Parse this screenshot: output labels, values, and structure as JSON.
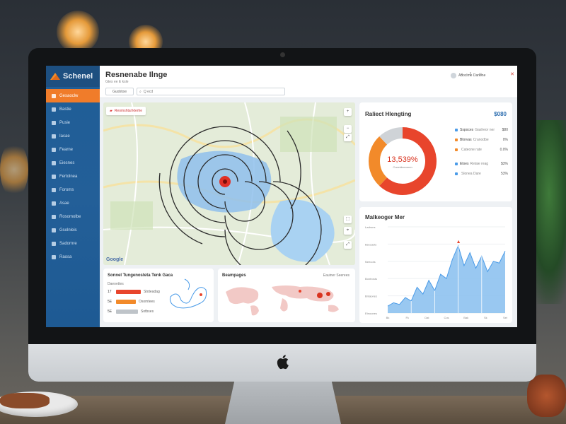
{
  "app": {
    "brand_name": "Schenel",
    "page_title": "Resnenabe Ilnge",
    "subtitle": "Gtes ee E ksle",
    "filter_label": "Guobtow",
    "search_placeholder": "Q ecd",
    "user_name": "Aboclme Danone"
  },
  "sidebar": {
    "items": [
      {
        "label": "Gesaoclw",
        "active": true
      },
      {
        "label": "Bastie"
      },
      {
        "label": "Pusie"
      },
      {
        "label": "Iacae"
      },
      {
        "label": "Fearne"
      },
      {
        "label": "Eiesnes"
      },
      {
        "label": "Fertolnea"
      },
      {
        "label": "Foroms"
      },
      {
        "label": "Asae"
      },
      {
        "label": "Rosomolbe"
      },
      {
        "label": "Gsolnleis"
      },
      {
        "label": "Sadornre"
      },
      {
        "label": "Raosa"
      }
    ]
  },
  "map": {
    "badge_label": "Reomshtal kIerhe",
    "attribution": "Google",
    "controls": [
      "+",
      "−",
      "⤢",
      "⬚",
      "⌖",
      "⤢"
    ]
  },
  "donut_card": {
    "title": "Raliect Hlengting",
    "value": "$080",
    "center_label": "13,539%",
    "center_sub": "Cneetdeeomen",
    "colors": {
      "red": "#e8452c",
      "orange": "#f28a2a",
      "gray": "#cfd3d7"
    },
    "chart_data": {
      "type": "pie",
      "slices": [
        {
          "label": "Sspoces",
          "value": 62,
          "color": "#e8452c"
        },
        {
          "label": "Blorvas",
          "value": 26,
          "color": "#f28a2a"
        },
        {
          "label": "Eloes",
          "value": 12,
          "color": "#cfd3d7"
        }
      ]
    },
    "legend": [
      {
        "label": "Sspoces",
        "sub": "Gasheor ner",
        "value": "$80"
      },
      {
        "label": "Blorvas",
        "sub": "Cranodbe",
        "value": "0%"
      },
      {
        "label": "",
        "sub": "Cateone rate",
        "value": "0.0%"
      },
      {
        "label": "Eloes",
        "sub": "Relaie reag",
        "value": "$3%"
      },
      {
        "label": "",
        "sub": "Slonea Dare",
        "value": "53%"
      }
    ]
  },
  "area_card": {
    "title": "Malkeoger Mer",
    "y_ticks": [
      "Ladrons",
      "Bsecasts",
      "Neecots",
      "Bontrosts",
      "Bntaones",
      "Etnoones"
    ],
    "x_ticks": [
      "Bk",
      "Fk",
      "Dat",
      "Cos",
      "Bak",
      "Sk",
      "Set"
    ],
    "colors": {
      "fill": "#8ec2f0",
      "line": "#4a9be8"
    },
    "chart_data": {
      "type": "area",
      "x": [
        0,
        1,
        2,
        3,
        4,
        5,
        6,
        7,
        8,
        9,
        10,
        11,
        12,
        13,
        14,
        15,
        16,
        17,
        18,
        19,
        20
      ],
      "values": [
        8,
        12,
        10,
        18,
        14,
        30,
        22,
        38,
        26,
        45,
        40,
        62,
        78,
        55,
        70,
        52,
        66,
        48,
        60,
        58,
        72
      ],
      "ylim": [
        0,
        100
      ]
    },
    "marker_label": "▲"
  },
  "bar_card": {
    "title": "Sonnel Tungenosteta Tenk Gaca",
    "sub": "Daeoettes",
    "rows": [
      {
        "label": "17",
        "value": 70,
        "color": "#e8452c",
        "text": "Stoteadag"
      },
      {
        "label": "5E",
        "value": 56,
        "color": "#f28a2a",
        "text": "Osomtees"
      },
      {
        "label": "5E",
        "value": 62,
        "color": "#bfc4c9",
        "text": "Sotbses"
      }
    ]
  },
  "world_card": {
    "title": "Beampages",
    "sub": "Eauiner Seerees",
    "colors": {
      "land": "#f2c9c6",
      "hot": "#d9331f"
    }
  }
}
